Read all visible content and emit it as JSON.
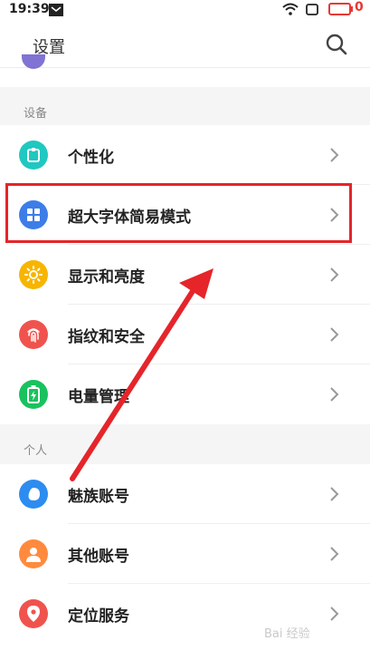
{
  "status": {
    "time": "19:39",
    "battery_text": "0"
  },
  "header": {
    "title": "设置"
  },
  "sections": {
    "device_header": "设备",
    "personal_header": "个人"
  },
  "items": [
    {
      "label": "个性化",
      "color": "#1fc8c0",
      "icon": "personalize-icon"
    },
    {
      "label": "超大字体简易模式",
      "color": "#3d7de8",
      "icon": "grid-icon"
    },
    {
      "label": "显示和亮度",
      "color": "#f7b500",
      "icon": "sun-icon"
    },
    {
      "label": "指纹和安全",
      "color": "#f0534d",
      "icon": "fingerprint-icon"
    },
    {
      "label": "电量管理",
      "color": "#19c25e",
      "icon": "battery-icon"
    },
    {
      "label": "魅族账号",
      "color": "#2d8cf0",
      "icon": "meizu-account-icon"
    },
    {
      "label": "其他账号",
      "color": "#ff8a3d",
      "icon": "person-icon"
    },
    {
      "label": "定位服务",
      "color": "#f0534d",
      "icon": "location-icon"
    }
  ],
  "watermark": "Bai 经验"
}
